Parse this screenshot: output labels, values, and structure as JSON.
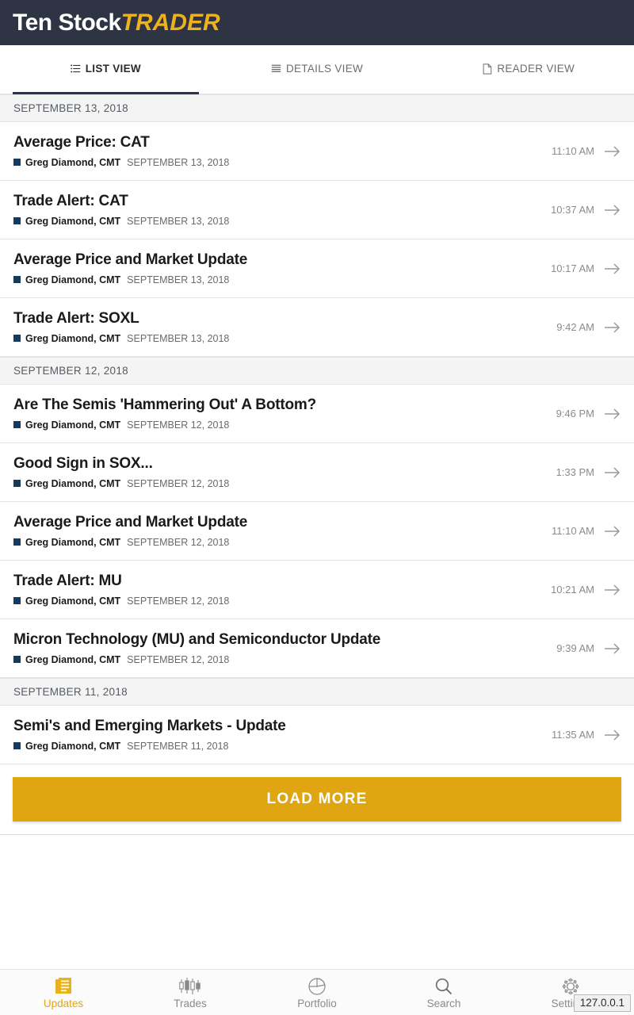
{
  "header": {
    "logo_part1": "Ten Stock",
    "logo_part2": "TRADER",
    "bg_color": "#2e3444",
    "accent_color": "#edb21e"
  },
  "tabs": [
    {
      "label": "LIST VIEW",
      "icon": "list-icon",
      "active": true
    },
    {
      "label": "DETAILS VIEW",
      "icon": "details-icon",
      "active": false
    },
    {
      "label": "READER VIEW",
      "icon": "document-icon",
      "active": false
    }
  ],
  "groups": [
    {
      "date_header": "SEPTEMBER 13, 2018",
      "items": [
        {
          "title": "Average Price: CAT",
          "author": "Greg Diamond, CMT",
          "date": "SEPTEMBER 13, 2018",
          "time": "11:10 AM"
        },
        {
          "title": "Trade Alert: CAT",
          "author": "Greg Diamond, CMT",
          "date": "SEPTEMBER 13, 2018",
          "time": "10:37 AM"
        },
        {
          "title": "Average Price and Market Update",
          "author": "Greg Diamond, CMT",
          "date": "SEPTEMBER 13, 2018",
          "time": "10:17 AM"
        },
        {
          "title": "Trade Alert: SOXL",
          "author": "Greg Diamond, CMT",
          "date": "SEPTEMBER 13, 2018",
          "time": "9:42 AM"
        }
      ]
    },
    {
      "date_header": "SEPTEMBER 12, 2018",
      "items": [
        {
          "title": "Are The Semis 'Hammering Out' A Bottom?",
          "author": "Greg Diamond, CMT",
          "date": "SEPTEMBER 12, 2018",
          "time": "9:46 PM"
        },
        {
          "title": "Good Sign in SOX...",
          "author": "Greg Diamond, CMT",
          "date": "SEPTEMBER 12, 2018",
          "time": "1:33 PM"
        },
        {
          "title": "Average Price and Market Update",
          "author": "Greg Diamond, CMT",
          "date": "SEPTEMBER 12, 2018",
          "time": "11:10 AM"
        },
        {
          "title": "Trade Alert: MU",
          "author": "Greg Diamond, CMT",
          "date": "SEPTEMBER 12, 2018",
          "time": "10:21 AM"
        },
        {
          "title": "Micron Technology (MU) and Semiconductor Update",
          "author": "Greg Diamond, CMT",
          "date": "SEPTEMBER 12, 2018",
          "time": "9:39 AM"
        }
      ]
    },
    {
      "date_header": "SEPTEMBER 11, 2018",
      "items": [
        {
          "title": "Semi's and Emerging Markets - Update",
          "author": "Greg Diamond, CMT",
          "date": "SEPTEMBER 11, 2018",
          "time": "11:35 AM"
        }
      ]
    }
  ],
  "load_more": {
    "label": "LOAD MORE",
    "color": "#e0a612"
  },
  "bottom_nav": [
    {
      "label": "Updates",
      "icon": "updates-icon",
      "active": true
    },
    {
      "label": "Trades",
      "icon": "candlestick-icon",
      "active": false
    },
    {
      "label": "Portfolio",
      "icon": "pie-chart-icon",
      "active": false
    },
    {
      "label": "Search",
      "icon": "search-icon",
      "active": false
    },
    {
      "label": "Settings",
      "icon": "gear-icon",
      "active": false
    }
  ],
  "status_bubble": {
    "text": "127.0.0.1"
  }
}
